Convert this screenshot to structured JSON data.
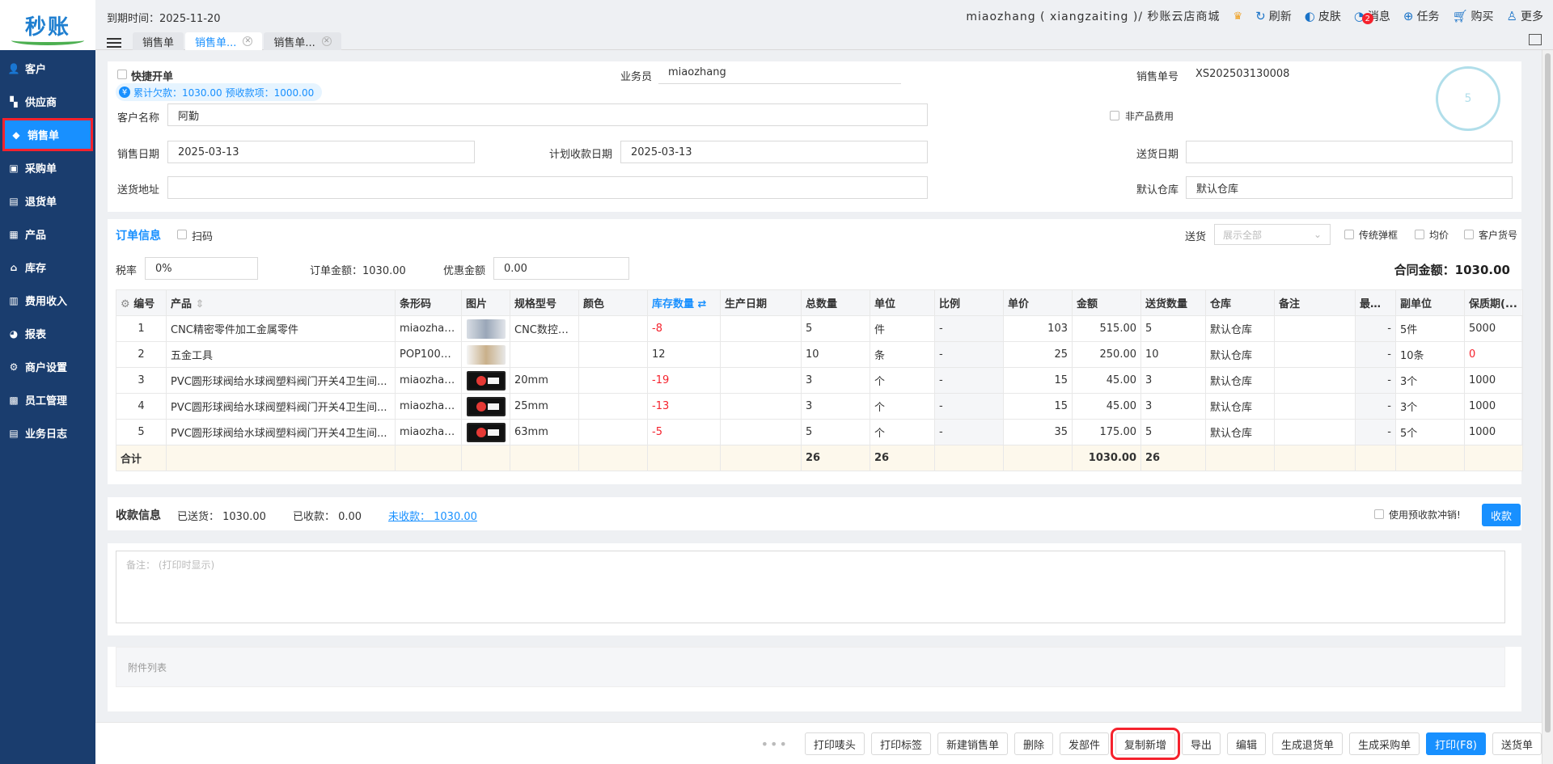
{
  "app": {
    "logo": "秒账"
  },
  "sidebar": {
    "items": [
      {
        "label": "客户",
        "icon": "user-icon",
        "glyph": "👤"
      },
      {
        "label": "供应商",
        "icon": "supplier-icon",
        "glyph": "▚"
      },
      {
        "label": "销售单",
        "icon": "tag-icon",
        "glyph": "◆"
      },
      {
        "label": "采购单",
        "icon": "cart-icon",
        "glyph": "▣"
      },
      {
        "label": "退货单",
        "icon": "return-icon",
        "glyph": "▤"
      },
      {
        "label": "产品",
        "icon": "box-icon",
        "glyph": "▦"
      },
      {
        "label": "库存",
        "icon": "warehouse-icon",
        "glyph": "⌂"
      },
      {
        "label": "费用收入",
        "icon": "finance-icon",
        "glyph": "▥"
      },
      {
        "label": "报表",
        "icon": "pie-chart-icon",
        "glyph": "◕"
      },
      {
        "label": "商户设置",
        "icon": "settings-icon",
        "glyph": "⚙"
      },
      {
        "label": "员工管理",
        "icon": "staff-icon",
        "glyph": "▩"
      },
      {
        "label": "业务日志",
        "icon": "log-icon",
        "glyph": "▤"
      }
    ]
  },
  "topbar": {
    "expire": "到期时间：2025-11-20",
    "account": "miaozhang ( xiangzaiting )/ 秒账云店商城",
    "refresh": "刷新",
    "skin": "皮肤",
    "message": "消息",
    "message_badge": "2",
    "task": "任务",
    "buy": "购买",
    "more": "更多"
  },
  "tabs": [
    {
      "label": "销售单"
    },
    {
      "label": "销售单..."
    },
    {
      "label": "销售单..."
    }
  ],
  "header": {
    "quick_order": "快捷开单",
    "salesman_label": "业务员",
    "salesman": "miaozhang",
    "order_no_label": "销售单号",
    "order_no": "XS202503130008",
    "debt": "累计欠款：1030.00",
    "prepay": "预收款项：1000.00",
    "debt_icon": "¥",
    "stamp": "5",
    "customer_label": "客户名称",
    "customer": "阿勤",
    "non_product": "非产品费用",
    "sale_date_label": "销售日期",
    "sale_date": "2025-03-13",
    "plan_date_label": "计划收款日期",
    "plan_date": "2025-03-13",
    "delivery_date_label": "送货日期",
    "delivery_date": "",
    "address_label": "送货地址",
    "address": "",
    "warehouse_label": "默认仓库",
    "warehouse": "默认仓库"
  },
  "order": {
    "title": "订单信息",
    "scan": "扫码",
    "delivery_label": "送货",
    "delivery_select": "展示全部",
    "traditional_popup": "传统弹框",
    "average_price": "均价",
    "customer_no": "客户货号",
    "tax_label": "税率",
    "tax": "0%",
    "amount": "订单金额：1030.00",
    "discount_label": "优惠金额",
    "discount": "0.00",
    "contract_total": "合同金额：",
    "contract_value": "1030.00"
  },
  "table": {
    "headers": [
      "编号",
      "产品",
      "条形码",
      "图片",
      "规格型号",
      "颜色",
      "库存数量",
      "生产日期",
      "总数量",
      "单位",
      "比例",
      "单价",
      "金额",
      "送货数量",
      "仓库",
      "备注",
      "最小...",
      "副单位",
      "保质期(..."
    ],
    "rows": [
      {
        "no": "1",
        "product": "CNC精密零件加工金属零件",
        "barcode": "miaozhan...",
        "img": "cnc",
        "spec": "CNC数控车...",
        "color": "",
        "stock": "-8",
        "mfg": "",
        "qty": "5",
        "unit": "件",
        "ratio": "-",
        "price": "103",
        "amount": "515.00",
        "ship": "5",
        "wh": "默认仓库",
        "note": "",
        "min": "-",
        "sub": "5件",
        "shelf": "5000",
        "shelf_red": false
      },
      {
        "no": "2",
        "product": "五金工具",
        "barcode": "POP1003...",
        "img": "tool",
        "spec": "",
        "color": "",
        "stock": "12",
        "mfg": "",
        "qty": "10",
        "unit": "条",
        "ratio": "-",
        "price": "25",
        "amount": "250.00",
        "ship": "10",
        "wh": "默认仓库",
        "note": "",
        "min": "-",
        "sub": "10条",
        "shelf": "0",
        "shelf_red": true
      },
      {
        "no": "3",
        "product": "PVC圆形球阀给水球阀塑料阀门开关4卫生间...",
        "barcode": "miaozhan...",
        "img": "pvc",
        "spec": "20mm",
        "color": "",
        "stock": "-19",
        "mfg": "",
        "qty": "3",
        "unit": "个",
        "ratio": "-",
        "price": "15",
        "amount": "45.00",
        "ship": "3",
        "wh": "默认仓库",
        "note": "",
        "min": "-",
        "sub": "3个",
        "shelf": "1000",
        "shelf_red": false
      },
      {
        "no": "4",
        "product": "PVC圆形球阀给水球阀塑料阀门开关4卫生间...",
        "barcode": "miaozhan...",
        "img": "pvc",
        "spec": "25mm",
        "color": "",
        "stock": "-13",
        "mfg": "",
        "qty": "3",
        "unit": "个",
        "ratio": "-",
        "price": "15",
        "amount": "45.00",
        "ship": "3",
        "wh": "默认仓库",
        "note": "",
        "min": "-",
        "sub": "3个",
        "shelf": "1000",
        "shelf_red": false
      },
      {
        "no": "5",
        "product": "PVC圆形球阀给水球阀塑料阀门开关4卫生间...",
        "barcode": "miaozhan...",
        "img": "pvc",
        "spec": "63mm",
        "color": "",
        "stock": "-5",
        "mfg": "",
        "qty": "5",
        "unit": "个",
        "ratio": "-",
        "price": "35",
        "amount": "175.00",
        "ship": "5",
        "wh": "默认仓库",
        "note": "",
        "min": "-",
        "sub": "5个",
        "shelf": "1000",
        "shelf_red": false
      }
    ],
    "total": {
      "label": "合计",
      "qty": "26",
      "unit": "26",
      "amount": "1030.00",
      "ship": "26"
    }
  },
  "payment": {
    "title": "收款信息",
    "shipped": "已送货：  1030.00",
    "received": "已收款：  0.00",
    "unreceived": "未收款：  1030.00",
    "use_prepay": "使用预收款冲销!",
    "collect": "收款"
  },
  "note": {
    "placeholder": "备注：  (打印时显示)"
  },
  "attach": {
    "label": "附件列表"
  },
  "footer": {
    "buttons": [
      {
        "label": "打印唛头",
        "name": "print-mark-button",
        "style": ""
      },
      {
        "label": "打印标签",
        "name": "print-label-button",
        "style": ""
      },
      {
        "label": "新建销售单",
        "name": "new-sales-order-button",
        "style": ""
      },
      {
        "label": "删除",
        "name": "delete-button",
        "style": ""
      },
      {
        "label": "发部件",
        "name": "send-parts-button",
        "style": ""
      },
      {
        "label": "复制新增",
        "name": "copy-new-button",
        "style": "boxed"
      },
      {
        "label": "导出",
        "name": "export-button",
        "style": ""
      },
      {
        "label": "编辑",
        "name": "edit-button",
        "style": ""
      },
      {
        "label": "生成退货单",
        "name": "generate-return-button",
        "style": ""
      },
      {
        "label": "生成采购单",
        "name": "generate-purchase-button",
        "style": ""
      },
      {
        "label": "打印(F8)",
        "name": "print-button",
        "style": "primary"
      },
      {
        "label": "送货单",
        "name": "delivery-note-button",
        "style": ""
      }
    ]
  },
  "colors": {
    "primary": "#1890ff",
    "sidebar": "#1a3d6e",
    "danger": "#f5222d"
  }
}
